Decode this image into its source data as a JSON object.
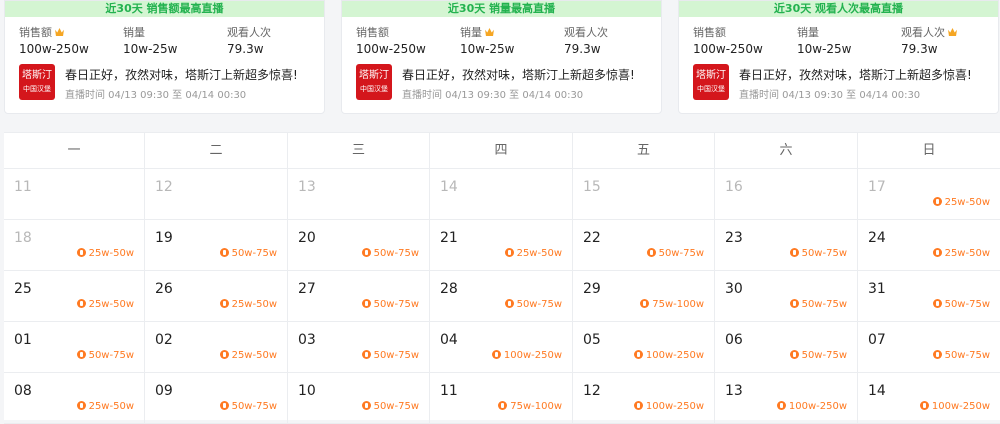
{
  "colors": {
    "banner_bg": "#d4f5d2",
    "banner_text": "#23b24f",
    "accent_orange": "#ff7a22",
    "logo_red": "#d4161c"
  },
  "cards": [
    {
      "banner": "近30天 销售额最高直播",
      "metrics": [
        {
          "label": "销售额",
          "value": "100w-250w",
          "crown": true
        },
        {
          "label": "销量",
          "value": "10w-25w",
          "crown": false
        },
        {
          "label": "观看人次",
          "value": "79.3w",
          "crown": false
        }
      ],
      "logo": {
        "mark": "塔斯汀",
        "text": "中国汉堡"
      },
      "live_title": "春日正好，孜然对味，塔斯汀上新超多惊喜!",
      "live_time": "直播时间 04/13 09:30 至 04/14 00:30"
    },
    {
      "banner": "近30天 销量最高直播",
      "metrics": [
        {
          "label": "销售额",
          "value": "100w-250w",
          "crown": false
        },
        {
          "label": "销量",
          "value": "10w-25w",
          "crown": true
        },
        {
          "label": "观看人次",
          "value": "79.3w",
          "crown": false
        }
      ],
      "logo": {
        "mark": "塔斯汀",
        "text": "中国汉堡"
      },
      "live_title": "春日正好，孜然对味，塔斯汀上新超多惊喜!",
      "live_time": "直播时间 04/13 09:30 至 04/14 00:30"
    },
    {
      "banner": "近30天 观看人次最高直播",
      "metrics": [
        {
          "label": "销售额",
          "value": "100w-250w",
          "crown": false
        },
        {
          "label": "销量",
          "value": "10w-25w",
          "crown": false
        },
        {
          "label": "观看人次",
          "value": "79.3w",
          "crown": true
        }
      ],
      "logo": {
        "mark": "塔斯汀",
        "text": "中国汉堡"
      },
      "live_title": "春日正好，孜然对味，塔斯汀上新超多惊喜!",
      "live_time": "直播时间 04/13 09:30 至 04/14 00:30"
    }
  ],
  "calendar": {
    "weekdays": [
      "一",
      "二",
      "三",
      "四",
      "五",
      "六",
      "日"
    ],
    "weeks": [
      [
        {
          "day": "11",
          "range": "",
          "muted": true
        },
        {
          "day": "12",
          "range": "",
          "muted": true
        },
        {
          "day": "13",
          "range": "",
          "muted": true
        },
        {
          "day": "14",
          "range": "",
          "muted": true
        },
        {
          "day": "15",
          "range": "",
          "muted": true
        },
        {
          "day": "16",
          "range": "",
          "muted": true
        },
        {
          "day": "17",
          "range": "25w-50w",
          "muted": true
        }
      ],
      [
        {
          "day": "18",
          "range": "25w-50w",
          "muted": true
        },
        {
          "day": "19",
          "range": "50w-75w",
          "muted": false
        },
        {
          "day": "20",
          "range": "50w-75w",
          "muted": false
        },
        {
          "day": "21",
          "range": "25w-50w",
          "muted": false
        },
        {
          "day": "22",
          "range": "50w-75w",
          "muted": false
        },
        {
          "day": "23",
          "range": "50w-75w",
          "muted": false
        },
        {
          "day": "24",
          "range": "25w-50w",
          "muted": false
        }
      ],
      [
        {
          "day": "25",
          "range": "25w-50w",
          "muted": false
        },
        {
          "day": "26",
          "range": "25w-50w",
          "muted": false
        },
        {
          "day": "27",
          "range": "50w-75w",
          "muted": false
        },
        {
          "day": "28",
          "range": "50w-75w",
          "muted": false
        },
        {
          "day": "29",
          "range": "75w-100w",
          "muted": false
        },
        {
          "day": "30",
          "range": "50w-75w",
          "muted": false
        },
        {
          "day": "31",
          "range": "50w-75w",
          "muted": false
        }
      ],
      [
        {
          "day": "01",
          "range": "50w-75w",
          "muted": false
        },
        {
          "day": "02",
          "range": "25w-50w",
          "muted": false
        },
        {
          "day": "03",
          "range": "50w-75w",
          "muted": false
        },
        {
          "day": "04",
          "range": "100w-250w",
          "muted": false
        },
        {
          "day": "05",
          "range": "100w-250w",
          "muted": false
        },
        {
          "day": "06",
          "range": "50w-75w",
          "muted": false
        },
        {
          "day": "07",
          "range": "50w-75w",
          "muted": false
        }
      ],
      [
        {
          "day": "08",
          "range": "25w-50w",
          "muted": false
        },
        {
          "day": "09",
          "range": "50w-75w",
          "muted": false
        },
        {
          "day": "10",
          "range": "50w-75w",
          "muted": false
        },
        {
          "day": "11",
          "range": "75w-100w",
          "muted": false
        },
        {
          "day": "12",
          "range": "100w-250w",
          "muted": false
        },
        {
          "day": "13",
          "range": "100w-250w",
          "muted": false
        },
        {
          "day": "14",
          "range": "100w-250w",
          "muted": false
        }
      ]
    ]
  }
}
